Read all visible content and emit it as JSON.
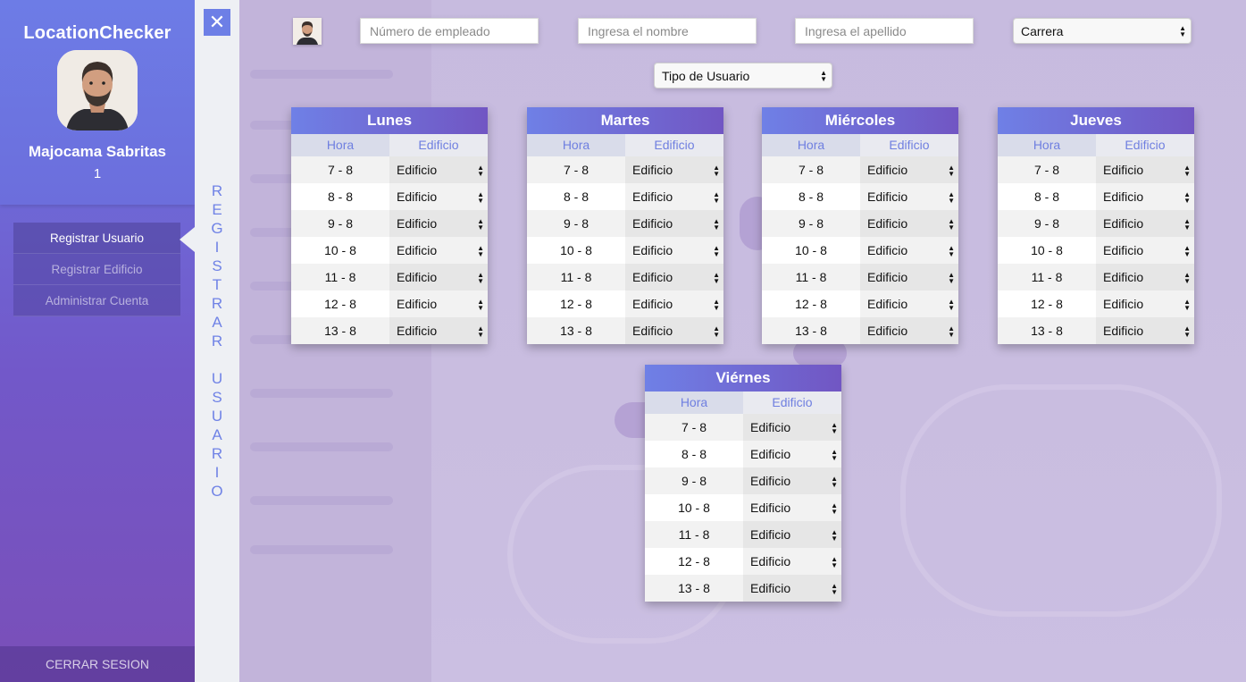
{
  "app": {
    "title": "LocationChecker"
  },
  "user": {
    "name": "Majocama Sabritas",
    "id": "1"
  },
  "menu": {
    "items": [
      {
        "label": "Registrar Usuario",
        "active": true
      },
      {
        "label": "Registrar Edificio",
        "active": false
      },
      {
        "label": "Administrar Cuenta",
        "active": false
      }
    ],
    "logout_label": "CERRAR SESION"
  },
  "strip": {
    "close_glyph": "✕",
    "vertical_word1": [
      "R",
      "E",
      "G",
      "I",
      "S",
      "T",
      "R",
      "A",
      "R"
    ],
    "vertical_word2": [
      "U",
      "S",
      "U",
      "A",
      "R",
      "I",
      "O"
    ]
  },
  "form": {
    "employee_number_placeholder": "Número de empleado",
    "first_name_placeholder": "Ingresa el nombre",
    "last_name_placeholder": "Ingresa el apellido",
    "career_select": "Carrera",
    "user_type_select": "Tipo de Usuario"
  },
  "schedule": {
    "col_hora": "Hora",
    "col_edificio": "Edificio",
    "days": [
      {
        "name": "Lunes"
      },
      {
        "name": "Martes"
      },
      {
        "name": "Miércoles"
      },
      {
        "name": "Jueves"
      },
      {
        "name": "Viérnes"
      }
    ],
    "hours": [
      "7 - 8",
      "8 - 8",
      "9 - 8",
      "10 - 8",
      "11 - 8",
      "12 - 8",
      "13 - 8"
    ],
    "building_default": "Edificio"
  },
  "icons": {
    "close": "close-icon",
    "select_arrows": "select-arrows-icon",
    "avatar": "user-avatar"
  },
  "colors": {
    "accent": "#6f80e6",
    "accent_dark": "#7156c3",
    "strip_bg": "#eef0f4"
  }
}
